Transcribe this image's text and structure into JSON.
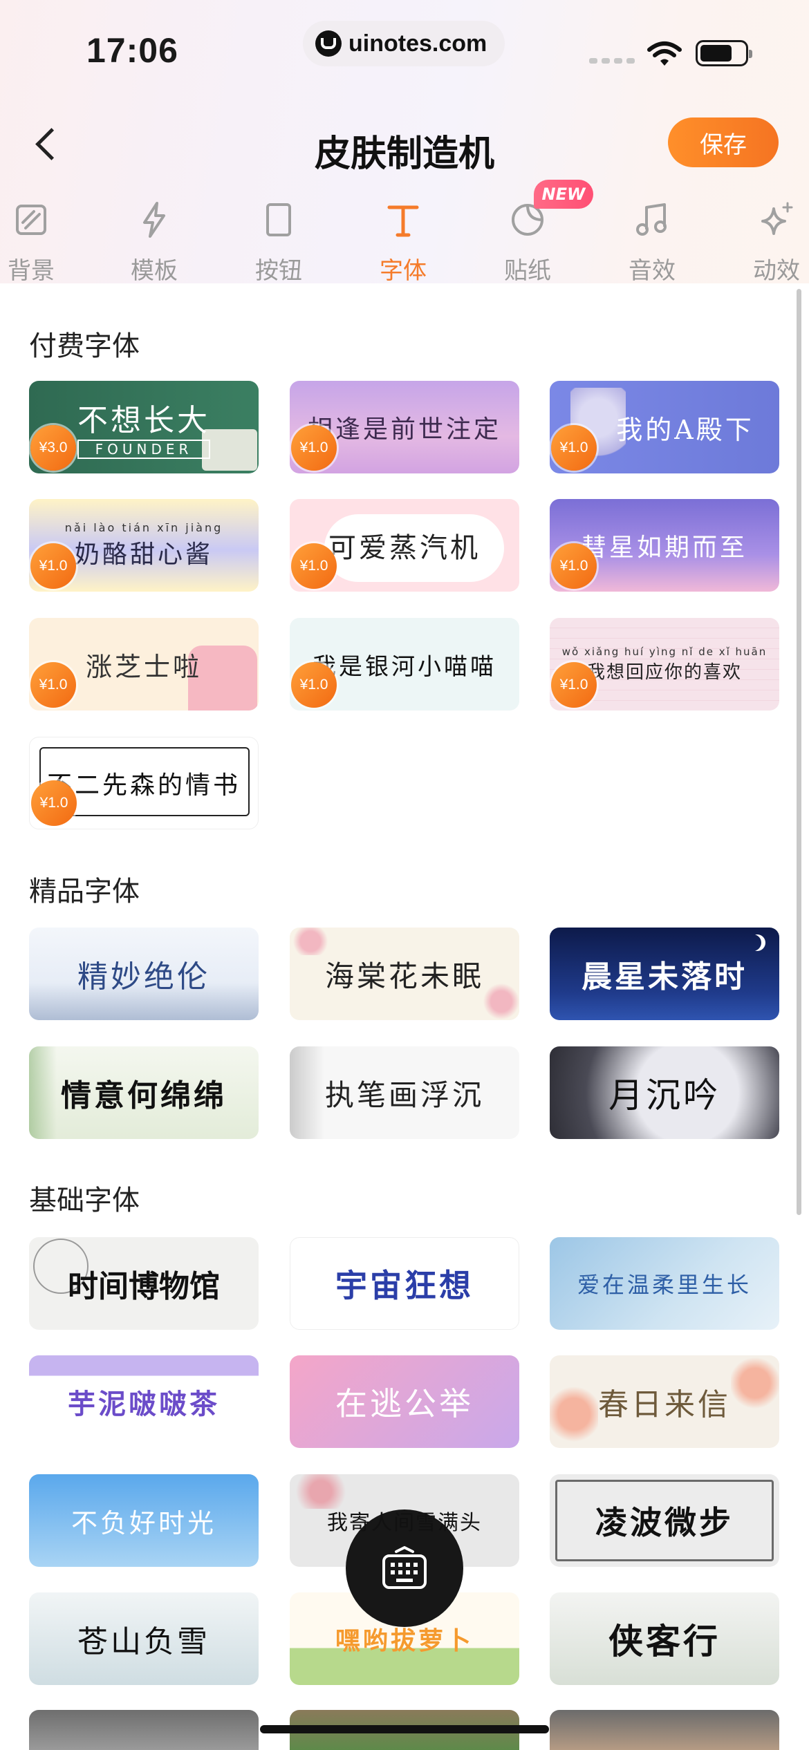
{
  "status_bar": {
    "time": "17:06",
    "url": "uinotes.com"
  },
  "header": {
    "title": "皮肤制造机",
    "save_label": "保存",
    "back_icon": "chevron-left-icon"
  },
  "tabs": [
    {
      "label": "背景",
      "icon": "background-icon"
    },
    {
      "label": "模板",
      "icon": "lightning-icon"
    },
    {
      "label": "按钮",
      "icon": "button-icon"
    },
    {
      "label": "字体",
      "icon": "font-icon",
      "active": true
    },
    {
      "label": "贴纸",
      "icon": "sticker-icon",
      "badge": "NEW"
    },
    {
      "label": "音效",
      "icon": "music-note-icon"
    },
    {
      "label": "动效",
      "icon": "sparkle-icon"
    }
  ],
  "sections": {
    "paid": {
      "title": "付费字体",
      "items": [
        {
          "text": "不想长大",
          "subtext": "FOUNDER",
          "price": "¥3.0"
        },
        {
          "text": "相逢是前世注定",
          "price": "¥1.0"
        },
        {
          "text": "我的A殿下",
          "price": "¥1.0"
        },
        {
          "text": "奶酪甜心酱",
          "pinyin": "nǎi lào tián xīn jiàng",
          "price": "¥1.0"
        },
        {
          "text": "可爱蒸汽机",
          "price": "¥1.0"
        },
        {
          "text": "彗星如期而至",
          "price": "¥1.0"
        },
        {
          "text": "涨芝士啦",
          "price": "¥1.0"
        },
        {
          "text": "我是银河小喵喵",
          "price": "¥1.0"
        },
        {
          "text": "我想回应你的喜欢",
          "pinyin": "wǒ xiǎng huí yìng nǐ de xǐ huān",
          "price": "¥1.0"
        },
        {
          "text": "不二先森的情书",
          "price": "¥1.0"
        }
      ]
    },
    "premium": {
      "title": "精品字体",
      "items": [
        {
          "text": "精妙绝伦"
        },
        {
          "text": "海棠花未眠"
        },
        {
          "text": "晨星未落时"
        },
        {
          "text": "情意何绵绵"
        },
        {
          "text": "执笔画浮沉"
        },
        {
          "text": "月沉吟"
        }
      ]
    },
    "basic": {
      "title": "基础字体",
      "items": [
        {
          "text": "时间博物馆"
        },
        {
          "text": "宇宙狂想"
        },
        {
          "text": "爱在温柔里生长"
        },
        {
          "text": "芋泥啵啵茶"
        },
        {
          "text": "在逃公举"
        },
        {
          "text": "春日来信"
        },
        {
          "text": "不负好时光"
        },
        {
          "text": "我寄人间雪满头"
        },
        {
          "text": "凌波微步"
        },
        {
          "text": "苍山负雪"
        },
        {
          "text": "嘿哟拔萝卜"
        },
        {
          "text": "侠客行"
        }
      ]
    }
  },
  "fab": {
    "icon": "keyboard-icon"
  },
  "colors": {
    "accent": "#f57b2a",
    "badge": "#ff5577",
    "fab": "#171717"
  }
}
